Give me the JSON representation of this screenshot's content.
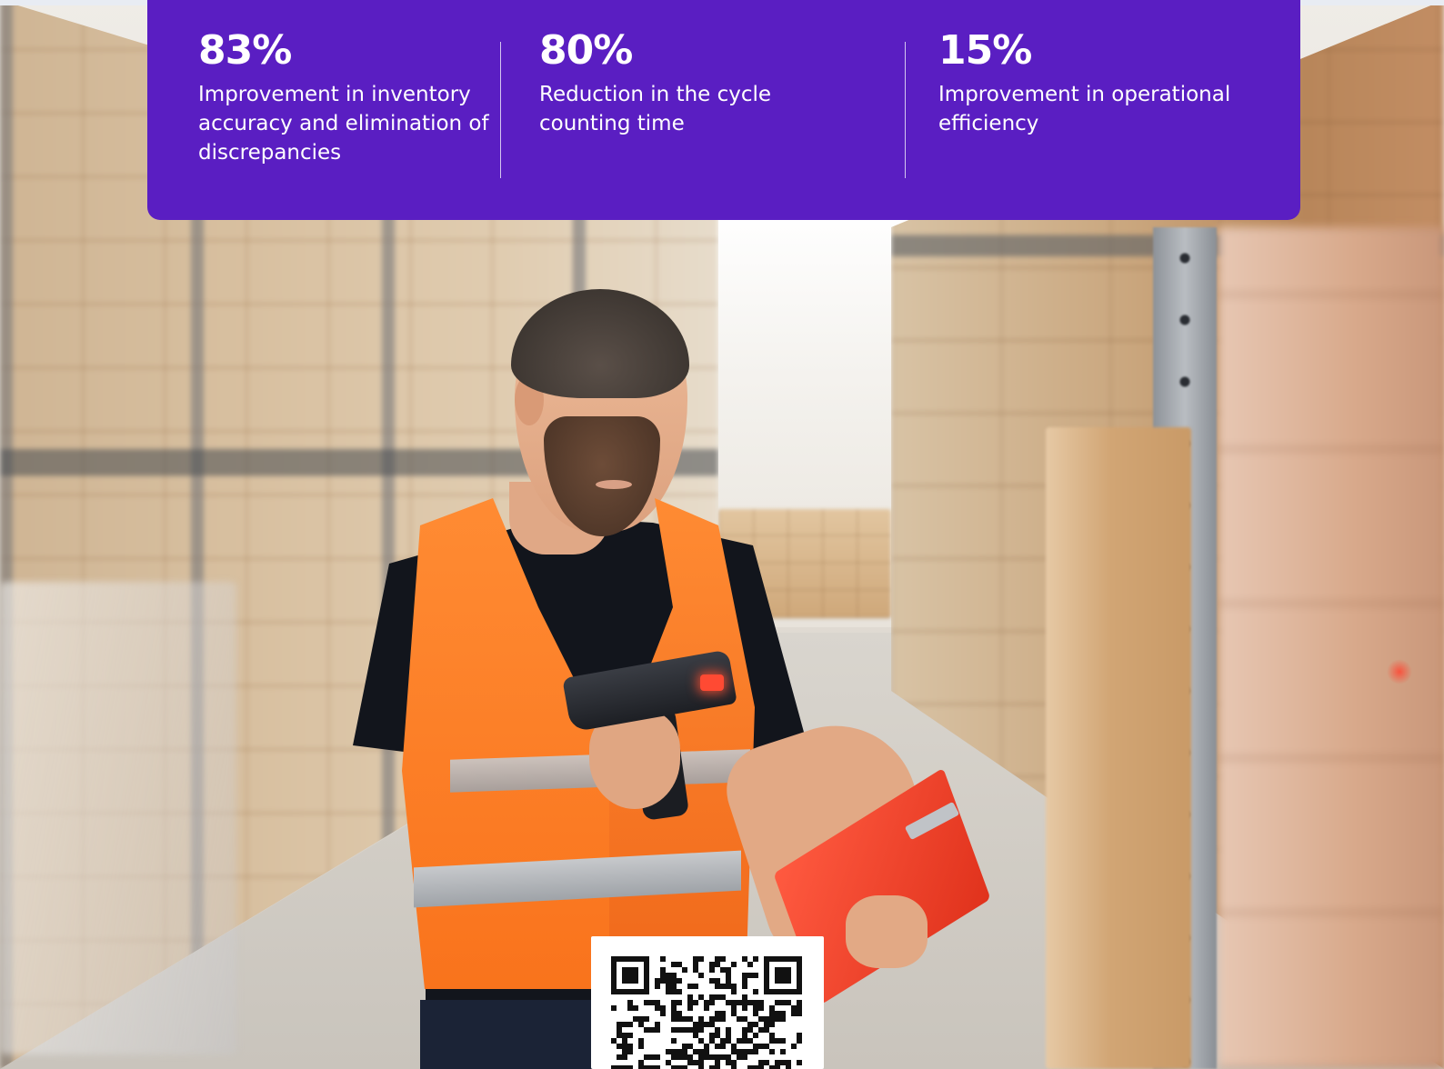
{
  "stats": [
    {
      "value": "83%",
      "description": "Improvement in inventory accuracy and elimination of discrepancies"
    },
    {
      "value": "80%",
      "description": "Reduction in the cycle counting time"
    },
    {
      "value": "15%",
      "description": "Improvement in operational efficiency"
    }
  ],
  "colors": {
    "banner_background": "#5a1ec2",
    "banner_text": "#ffffff",
    "vest": "#f9731c"
  },
  "icons": {
    "qr": "qr-code-icon"
  }
}
